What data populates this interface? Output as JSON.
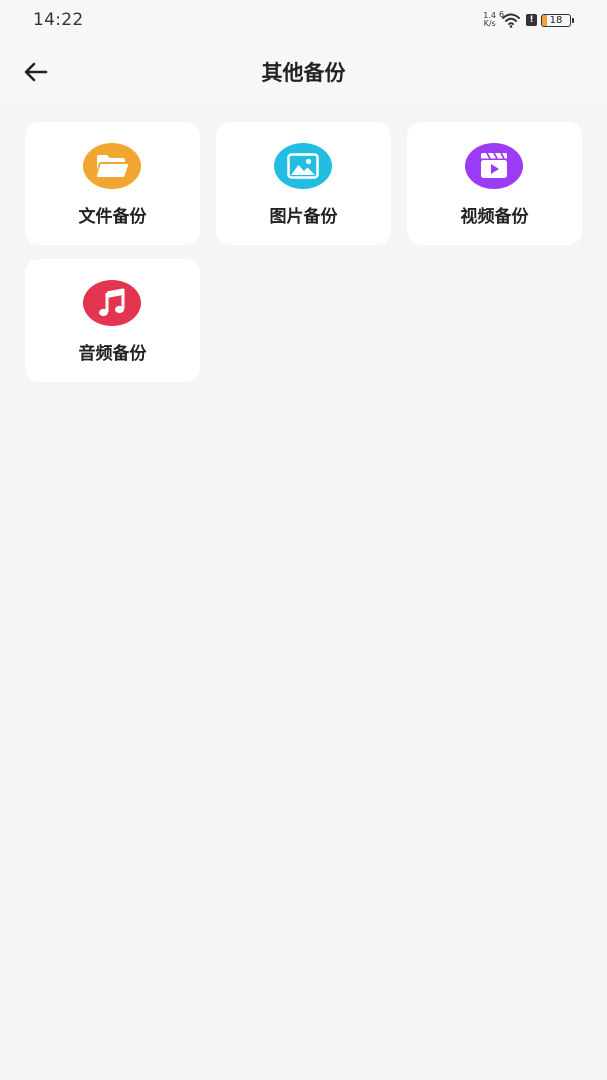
{
  "status_bar": {
    "time": "14:22",
    "net_speed_value": "1.4",
    "net_speed_unit": "K/s",
    "wifi_badge": "6",
    "alert_glyph": "!",
    "battery_level": "18",
    "battery_fraction": 0.18,
    "battery_color": "#f2a232"
  },
  "header": {
    "back_icon": "arrow-left-icon",
    "title": "其他备份"
  },
  "backup_items": [
    {
      "label": "文件备份",
      "icon": "folder-icon",
      "color": "#f2a632"
    },
    {
      "label": "图片备份",
      "icon": "image-icon",
      "color": "#22bde0"
    },
    {
      "label": "视频备份",
      "icon": "video-icon",
      "color": "#9b3cf4"
    },
    {
      "label": "音频备份",
      "icon": "music-icon",
      "color": "#e43550"
    }
  ]
}
